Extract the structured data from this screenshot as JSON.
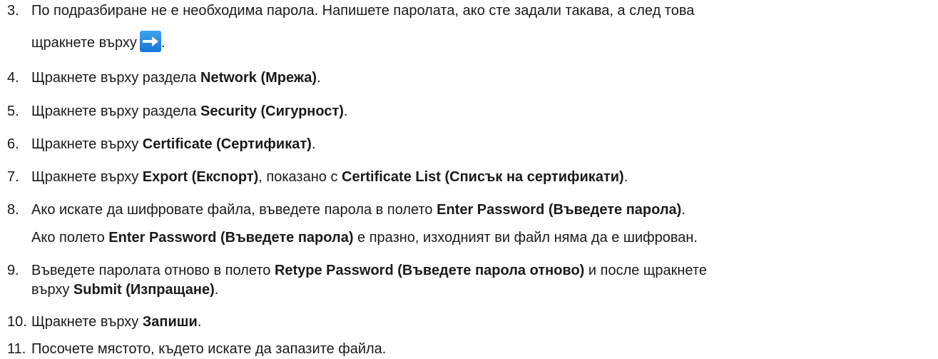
{
  "steps": [
    {
      "num": "3.",
      "line1": "По подразбиране не е необходима парола. Напишете паролата, ако сте задали такава, а след това",
      "line2_prefix": "щракнете върху",
      "line2_suffix": ".",
      "icon": "arrow-right-icon",
      "icon_color": "#1a7fe0"
    },
    {
      "num": "4.",
      "pre": "Щракнете върху раздела ",
      "bold": "Network (Мрежа)",
      "post": "."
    },
    {
      "num": "5.",
      "pre": "Щракнете върху раздела ",
      "bold": "Security (Сигурност)",
      "post": "."
    },
    {
      "num": "6.",
      "pre": "Щракнете върху ",
      "bold": "Certificate (Сертификат)",
      "post": "."
    },
    {
      "num": "7.",
      "pre": "Щракнете върху ",
      "bold": "Export (Експорт)",
      "mid": ", показано с ",
      "bold2": "Certificate List (Списък на сертификати)",
      "post": "."
    },
    {
      "num": "8.",
      "pre": "Ако искате да шифровате файла, въведете парола в полето ",
      "bold": "Enter Password (Въведете парола)",
      "post": ".",
      "note_pre": "Ако полето ",
      "note_bold": "Enter Password (Въведете парола)",
      "note_post": " е празно, изходният ви файл няма да е шифрован."
    },
    {
      "num": "9.",
      "pre": "Въведете паролата отново в полето ",
      "bold": "Retype Password (Въведете парола отново)",
      "mid": " и после щракнете",
      "line2_pre": "върху ",
      "line2_bold": "Submit (Изпращане)",
      "line2_post": "."
    },
    {
      "num": "10.",
      "pre": "Щракнете върху ",
      "bold": "Запиши",
      "post": "."
    },
    {
      "num": "11.",
      "pre": "Посочете мястото, където искате да запазите файла."
    }
  ]
}
